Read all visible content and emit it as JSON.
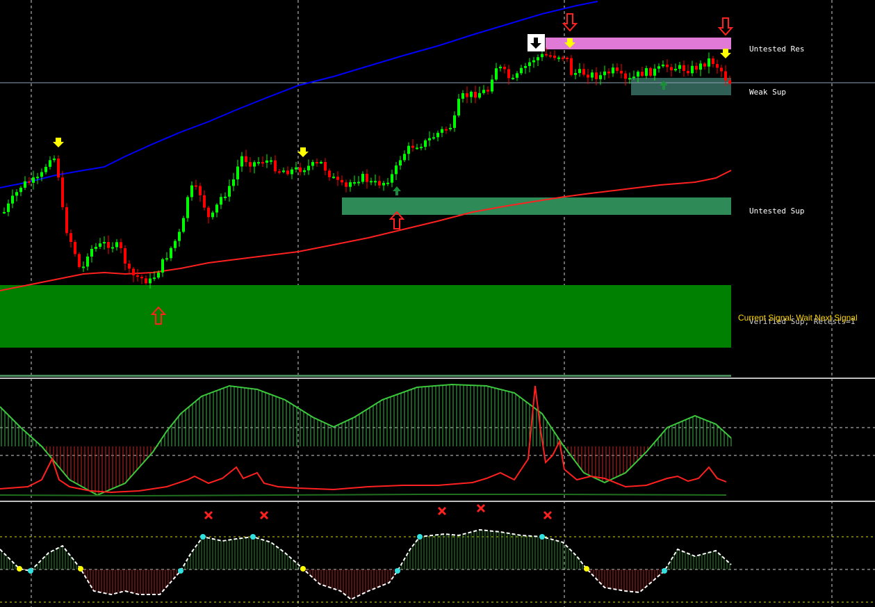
{
  "zones": {
    "untested_res": "Untested Res",
    "weak_sup": "Weak Sup",
    "untested_sup": "Untested Sup",
    "verified_sup": "Verified Sup, Retests=1"
  },
  "signal_text": "Current Signal: Wait Next Signal",
  "colors": {
    "background": "#000000",
    "bull_candle": "#00ff00",
    "bear_candle": "#ff0000",
    "ma_slow": "#0000ff",
    "ma_fast": "#ff0000",
    "zone_resistance": "#e07ad6",
    "zone_weak_support": "#2f5f55",
    "zone_untested_support": "#2e8b57",
    "zone_verified_support": "#008000",
    "signal_text": "#ffd700",
    "osc_positive": "#3cb44b",
    "osc_negative": "#cc2222",
    "dot_cyan": "#33e0e0",
    "dot_yellow": "#ffff00"
  },
  "icons": {
    "down_arrow_outline": "down-arrow-outline-icon",
    "up_arrow_outline": "up-arrow-outline-icon",
    "yellow_down_arrow": "yellow-down-arrow-icon",
    "green_up_arrow": "green-up-arrow-icon",
    "black_down_arrow_box": "black-down-arrow-box-icon",
    "cross_marker": "red-cross-icon"
  }
}
